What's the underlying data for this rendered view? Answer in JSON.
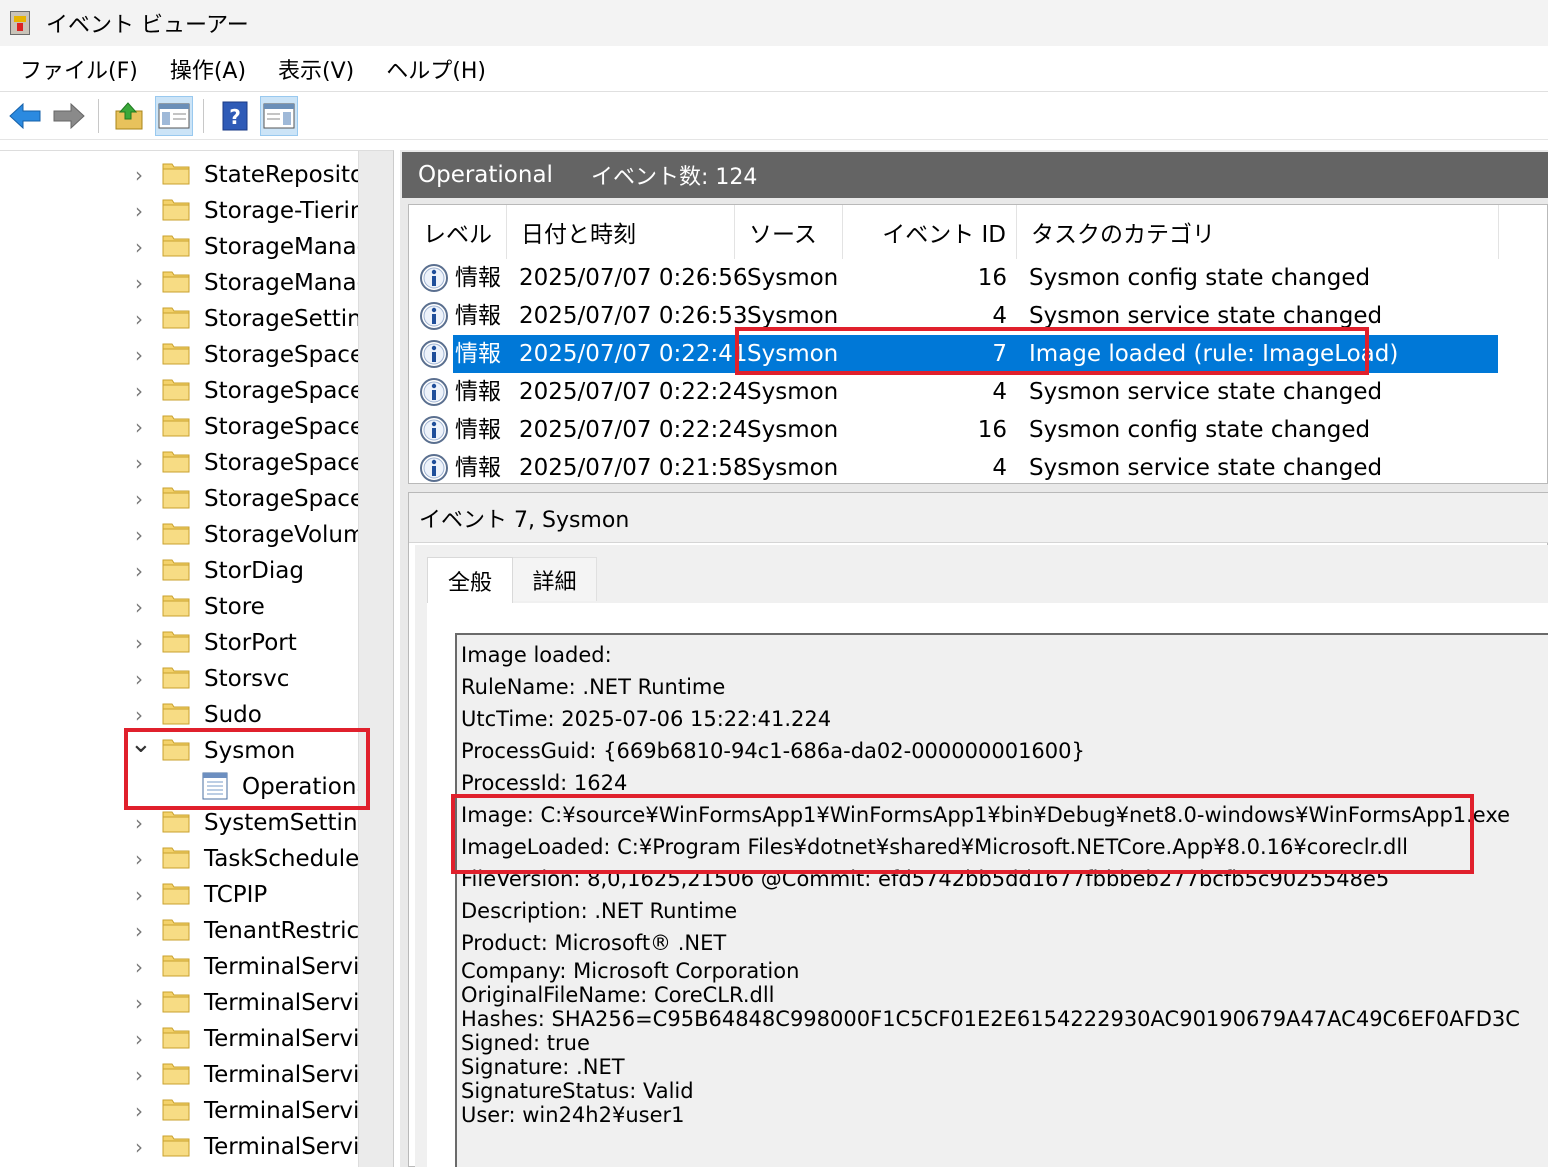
{
  "window": {
    "title": "イベント ビューアー"
  },
  "menu": [
    "ファイル(F)",
    "操作(A)",
    "表示(V)",
    "ヘルプ(H)"
  ],
  "toolbar": {
    "items": [
      "back-icon",
      "forward-icon",
      "up-folder-icon",
      "show-hide-tree-icon",
      "help-icon",
      "show-hide-action-icon"
    ]
  },
  "tree": {
    "items": [
      "StateRepositor",
      "Storage-Tiering",
      "StorageManag",
      "StorageManag",
      "StorageSetting",
      "StorageSpaces",
      "StorageSpaces",
      "StorageSpaces",
      "StorageSpaces",
      "StorageSpaces",
      "StorageVolume",
      "StorDiag",
      "Store",
      "StorPort",
      "Storsvc",
      "Sudo",
      "Sysmon"
    ],
    "child": "Operational",
    "items_after": [
      "SystemSettings",
      "TaskScheduler",
      "TCPIP",
      "TenantRestricti",
      "TerminalService",
      "TerminalService",
      "TerminalService",
      "TerminalService",
      "TerminalService",
      "TerminalService"
    ]
  },
  "log": {
    "title": "Operational",
    "count": "イベント数: 124"
  },
  "grid": {
    "headers": [
      "レベル",
      "日付と時刻",
      "ソース",
      "イベント ID",
      "タスクのカテゴリ"
    ],
    "rows": [
      {
        "level": "情報",
        "datetime": "2025/07/07 0:26:56",
        "source": "Sysmon",
        "id": "16",
        "category": "Sysmon config state changed"
      },
      {
        "level": "情報",
        "datetime": "2025/07/07 0:26:53",
        "source": "Sysmon",
        "id": "4",
        "category": "Sysmon service state changed"
      },
      {
        "level": "情報",
        "datetime": "2025/07/07 0:22:41",
        "source": "Sysmon",
        "id": "7",
        "category": "Image loaded (rule: ImageLoad)"
      },
      {
        "level": "情報",
        "datetime": "2025/07/07 0:22:24",
        "source": "Sysmon",
        "id": "4",
        "category": "Sysmon service state changed"
      },
      {
        "level": "情報",
        "datetime": "2025/07/07 0:22:24",
        "source": "Sysmon",
        "id": "16",
        "category": "Sysmon config state changed"
      },
      {
        "level": "情報",
        "datetime": "2025/07/07 0:21:58",
        "source": "Sysmon",
        "id": "4",
        "category": "Sysmon service state changed"
      }
    ]
  },
  "detail": {
    "header": "イベント 7, Sysmon",
    "tabs": [
      "全般",
      "詳細"
    ],
    "lines": [
      "Image loaded:",
      "RuleName: .NET Runtime",
      "UtcTime: 2025-07-06 15:22:41.224",
      "ProcessGuid: {669b6810-94c1-686a-da02-000000001600}",
      "ProcessId: 1624",
      "Image: C:¥source¥WinFormsApp1¥WinFormsApp1¥bin¥Debug¥net8.0-windows¥WinFormsApp1.exe",
      "ImageLoaded: C:¥Program Files¥dotnet¥shared¥Microsoft.NETCore.App¥8.0.16¥coreclr.dll",
      "FileVersion: 8,0,1625,21506 @Commit: efd5742bb5dd1677fbbbeb277bcfb5c9025548e5",
      "Description: .NET Runtime",
      "Product: Microsoft® .NET",
      "Company: Microsoft Corporation",
      "OriginalFileName: CoreCLR.dll",
      "Hashes: SHA256=C95B64848C998000F1C5CF01E2E6154222930AC90190679A47AC49C6EF0AFD3C",
      "Signed: true",
      "Signature: .NET",
      "SignatureStatus: Valid",
      "User: win24h2¥user1"
    ]
  },
  "colors": {
    "selection": "#0078d7",
    "highlight": "#e0202c",
    "header": "#646464"
  }
}
